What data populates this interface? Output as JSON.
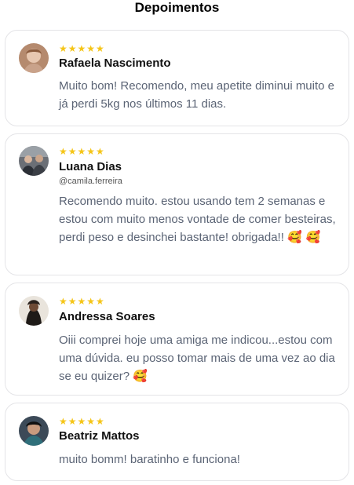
{
  "section": {
    "title": "Depoimentos"
  },
  "rating_stars": "★★★★★",
  "testimonials": [
    {
      "name": "Rafaela Nascimento",
      "handle": "",
      "rating": 5,
      "text": "Muito bom! Recomendo, meu apetite diminui muito e já perdi 5kg nos últimos 11 dias.",
      "emoji": ""
    },
    {
      "name": "Luana Dias",
      "handle": "@camila.ferreira",
      "rating": 5,
      "text": "Recomendo muito. estou usando tem 2 semanas e estou com muito menos vontade de comer besteiras, perdi peso e desinchei bastante! obrigada!!",
      "emoji": "🥰 🥰"
    },
    {
      "name": "Andressa Soares",
      "handle": "",
      "rating": 5,
      "text": "Oiii comprei hoje uma amiga me indicou...estou com uma dúvida. eu posso tomar mais de uma vez ao dia se eu quizer?",
      "emoji": "🥰"
    },
    {
      "name": "Beatriz Mattos",
      "handle": "",
      "rating": 5,
      "text": "muito bomm! baratinho e funciona!",
      "emoji": ""
    }
  ],
  "colors": {
    "star": "#f5c518",
    "body_text": "#5b6475",
    "border": "#e4e4e7"
  }
}
